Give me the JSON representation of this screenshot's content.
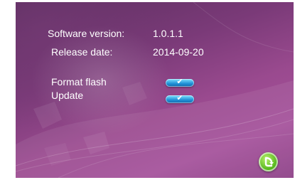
{
  "info": {
    "software_version_label": "Software version:",
    "software_version_value": "1.0.1.1",
    "release_date_label": "Release date:",
    "release_date_value": "2014-09-20"
  },
  "actions": {
    "format_flash_label": "Format flash",
    "update_label": "Update",
    "confirm_glyph": "✔"
  },
  "icons": {
    "confirm": "check-icon",
    "back": "back-arrow-icon"
  },
  "colors": {
    "background": "#8c3f86",
    "toggle_blue": "#1e8fd6",
    "back_green": "#59b81f"
  }
}
